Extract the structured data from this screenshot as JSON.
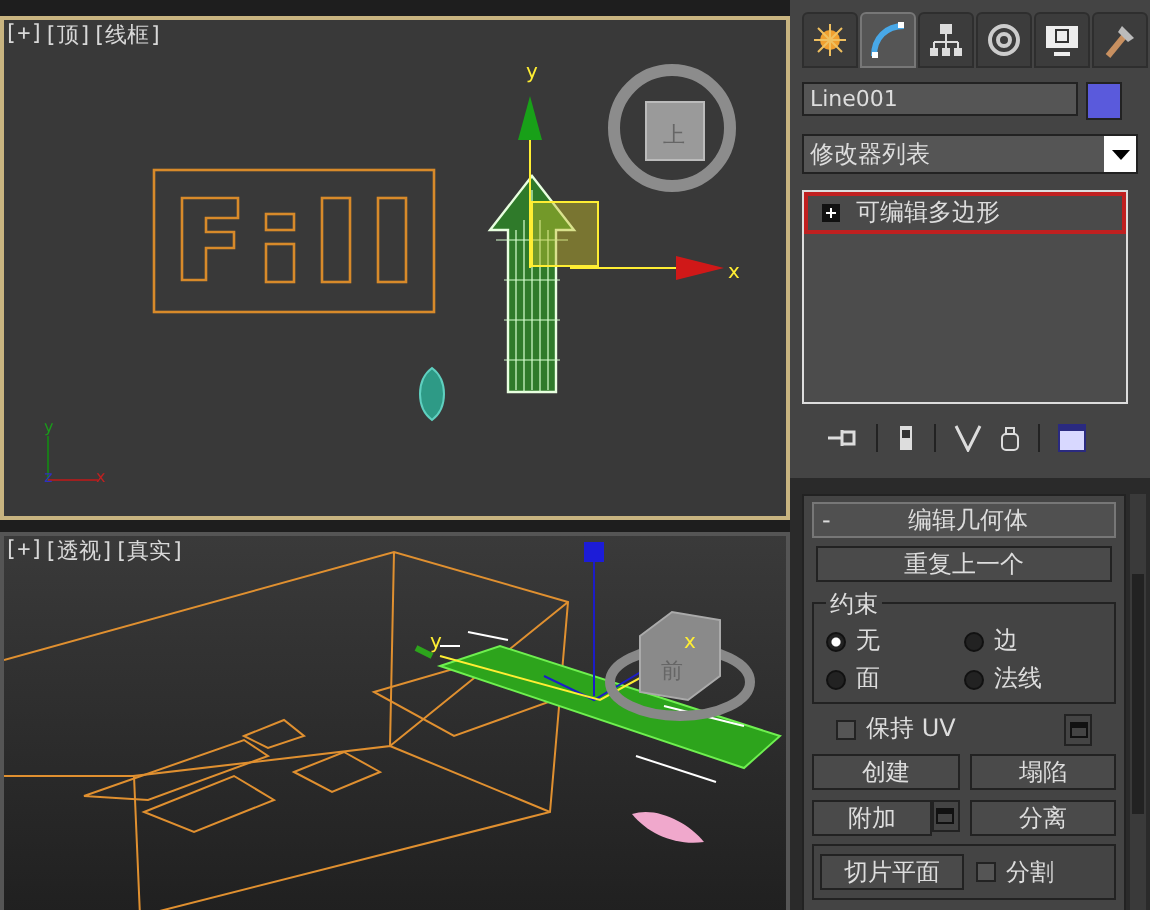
{
  "viewports": [
    {
      "labels": [
        "[+]",
        "[顶]",
        "[线框]"
      ],
      "active": true,
      "gizmo_labels": [
        "y",
        "x"
      ],
      "corner_axis_labels": [
        "y",
        "z",
        "x"
      ],
      "viewcube_label": "上"
    },
    {
      "labels": [
        "[+]",
        "[透视]",
        "[真实]"
      ],
      "active": false,
      "gizmo_labels": [
        "y",
        "x"
      ],
      "viewcube_label": "前"
    }
  ],
  "command_panel": {
    "tabs": [
      {
        "kind": "create",
        "selected": false
      },
      {
        "kind": "modify",
        "selected": true
      },
      {
        "kind": "hierarchy",
        "selected": false
      },
      {
        "kind": "motion",
        "selected": false
      },
      {
        "kind": "display",
        "selected": false
      },
      {
        "kind": "utilities",
        "selected": false
      }
    ],
    "object_name": "Line001",
    "modifier_list": "修改器列表",
    "stack": [
      {
        "label": "可编辑多边形",
        "expanded": false,
        "highlighted": true
      }
    ],
    "rollout": {
      "title": "编辑几何体",
      "toggle": "-",
      "repeat_button": "重复上一个",
      "constraints": {
        "title": "约束",
        "options": [
          {
            "label": "无",
            "selected": true
          },
          {
            "label": "边",
            "selected": false
          },
          {
            "label": "面",
            "selected": false
          },
          {
            "label": "法线",
            "selected": false
          }
        ]
      },
      "preserve_uv": {
        "label": "保持 UV",
        "checked": false
      },
      "buttons": [
        {
          "label": "创建",
          "kind": "plain"
        },
        {
          "label": "塌陷",
          "kind": "plain"
        },
        {
          "label": "附加",
          "kind": "with-settings"
        },
        {
          "label": "分离",
          "kind": "plain"
        }
      ],
      "slice_plane": "切片平面",
      "split": {
        "label": "分割",
        "checked": false
      }
    }
  }
}
